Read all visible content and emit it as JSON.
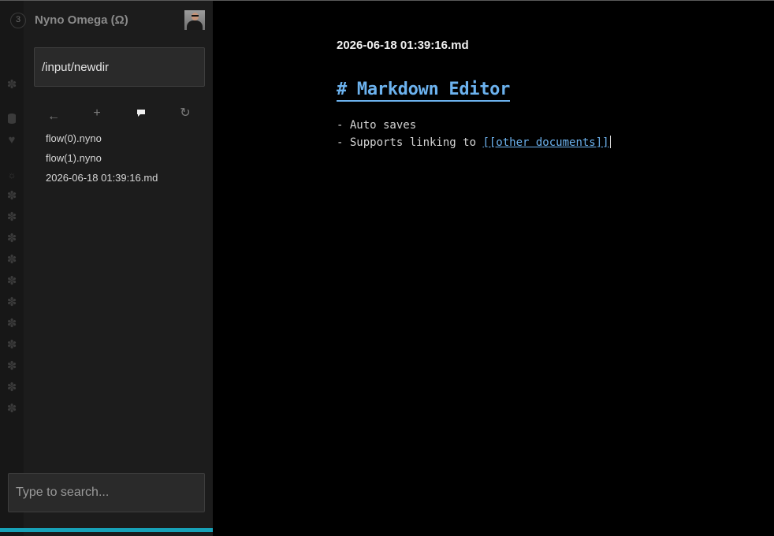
{
  "app": {
    "title": "Nyno Omega (Ω)",
    "logo_glyph": "3",
    "avatar": "user-avatar"
  },
  "sidebar": {
    "path_value": "/input/newdir",
    "toolbar": {
      "back": "←",
      "add": "+",
      "comment": "▰",
      "refresh": "↻"
    },
    "files": [
      "flow(0).nyno",
      "flow(1).nyno",
      "2026-06-18 01:39:16.md"
    ],
    "rail_icons": [
      "puzzle-icon",
      "database-icon",
      "heart-icon",
      "settings-icon",
      "puzzle-icon",
      "puzzle-icon",
      "puzzle-icon",
      "puzzle-icon",
      "puzzle-icon",
      "puzzle-icon",
      "puzzle-icon",
      "puzzle-icon",
      "puzzle-icon",
      "puzzle-icon",
      "puzzle-icon"
    ],
    "search_placeholder": "Type to search...",
    "progress": 1.0
  },
  "editor": {
    "file_name": "2026-06-18 01:39:16.md",
    "heading": "# Markdown Editor",
    "line1": "- Auto saves",
    "line2_prefix": "- Supports linking to ",
    "line2_link": "[[other documents]]"
  },
  "colors": {
    "accent": "#17a2b8",
    "link": "#6cb2ee",
    "background": "#000000",
    "sidebar": "#1c1c1c"
  }
}
